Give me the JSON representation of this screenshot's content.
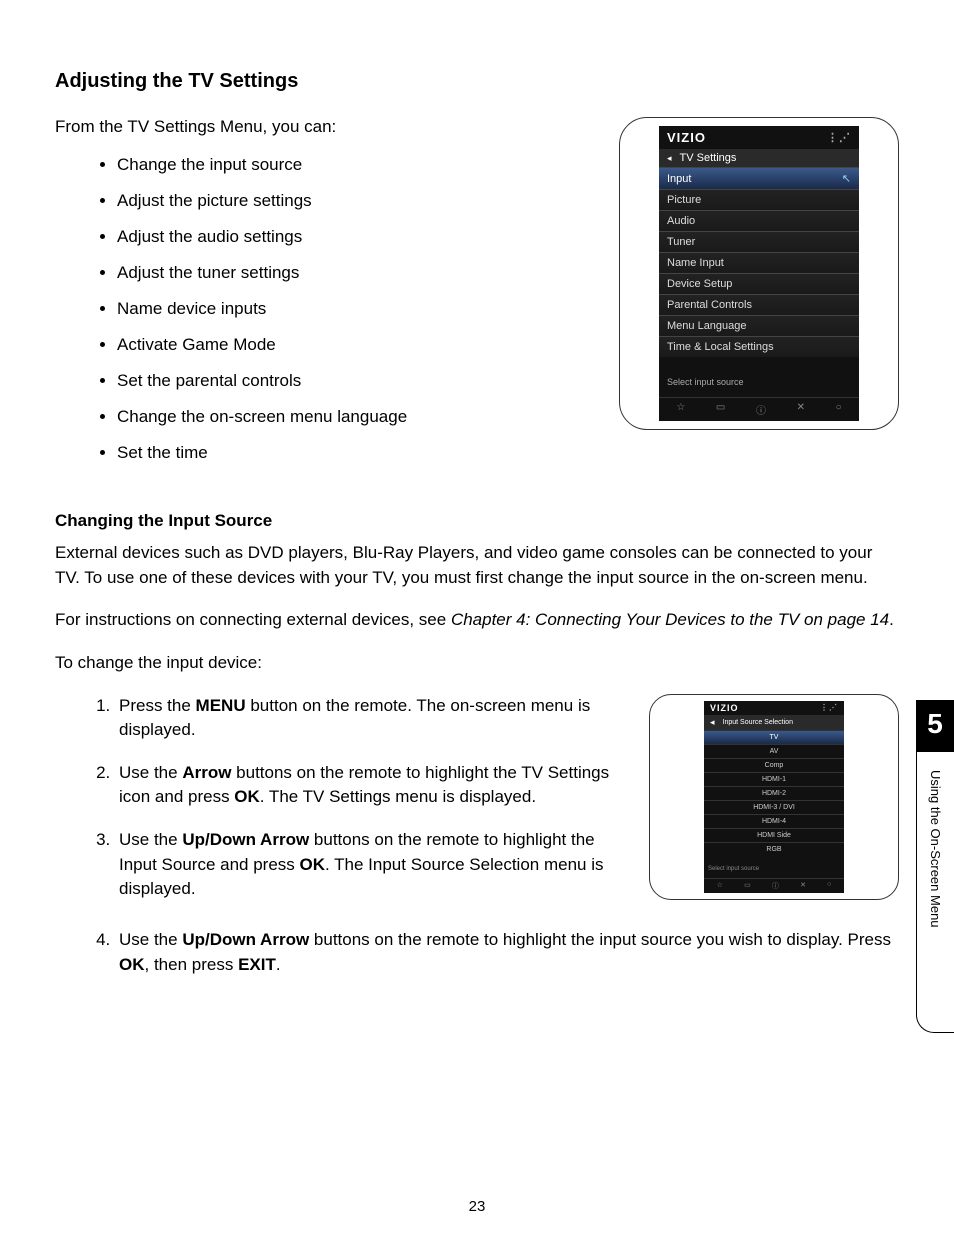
{
  "heading": "Adjusting the TV Settings",
  "intro": "From the TV Settings Menu, you can:",
  "bullets": [
    "Change the input source",
    "Adjust the picture settings",
    "Adjust the audio settings",
    "Adjust the tuner settings",
    "Name device inputs",
    "Activate Game Mode",
    "Set the parental controls",
    "Change the on-screen menu language",
    "Set the time"
  ],
  "subheading": "Changing the Input Source",
  "para1": "External devices such as DVD players, Blu-Ray Players, and video game consoles can be connected to your TV. To use one of these devices with your TV, you must first change the input source in the on-screen menu.",
  "para2_a": "For instructions on connecting external devices, see ",
  "para2_ref": "Chapter 4: Connecting Your Devices to the TV on page 14",
  "para2_b": ".",
  "para3": "To change the input device:",
  "steps": {
    "s1a": "Press the ",
    "s1b": "MENU",
    "s1c": " button on the remote. The on-screen menu is displayed.",
    "s2a": "Use the ",
    "s2b": "Arrow",
    "s2c": " buttons on the remote to highlight the TV Settings icon and press ",
    "s2d": "OK",
    "s2e": ". The TV Settings menu is displayed.",
    "s3a": "Use the ",
    "s3b": "Up/Down Arrow",
    "s3c": " buttons on the remote to highlight the Input Source and press ",
    "s3d": "OK",
    "s3e": ". The Input Source Selection menu is displayed.",
    "s4a": "Use the ",
    "s4b": "Up/Down Arrow",
    "s4c": " buttons on the remote to highlight the input source you wish to display. Press ",
    "s4d": "OK",
    "s4e": ", then press ",
    "s4f": "EXIT",
    "s4g": "."
  },
  "figure1": {
    "brand": "VIZIO",
    "title": "TV Settings",
    "selected": "Input",
    "items": [
      "Picture",
      "Audio",
      "Tuner",
      "Name Input",
      "Device Setup",
      "Parental Controls",
      "Menu Language",
      "Time & Local Settings"
    ],
    "hint": "Select input source"
  },
  "figure2": {
    "brand": "VIZIO",
    "title": "Input Source Selection",
    "items": [
      "TV",
      "AV",
      "Comp",
      "HDMI-1",
      "HDMI-2",
      "HDMI-3 / DVI",
      "HDMI-4",
      "HDMI Side",
      "RGB"
    ],
    "selected_index": 0,
    "hint": "Select input source"
  },
  "page_number": "23",
  "side_tab": {
    "number": "5",
    "label": "Using the On-Screen Menu"
  }
}
